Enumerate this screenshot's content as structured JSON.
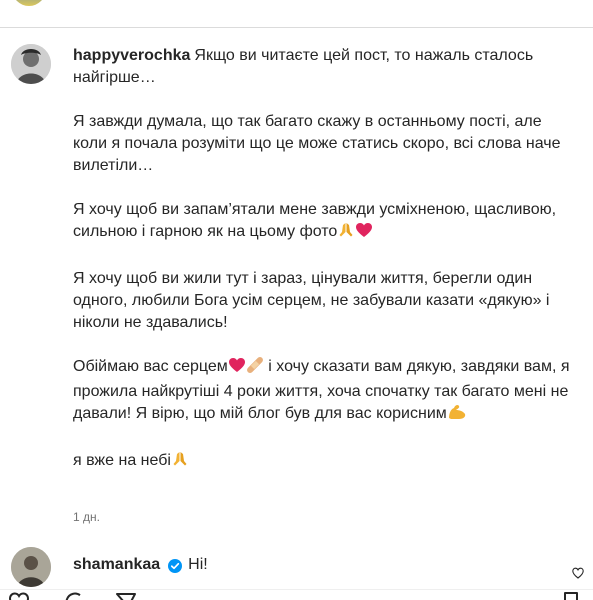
{
  "post": {
    "username": "happyverochka",
    "paragraphs": [
      "Якщо ви читаєте цей пост, то нажаль сталось найгірше…",
      "Я завжди думала, що так багато скажу в останньому пості, але коли я почала розуміти що це може статись скоро, всі слова наче вилетіли…",
      "Я хочу щоб ви запам’ятали мене завжди усміхненою, щасливою, сильною і гарною як на цьому фото",
      "Я хочу щоб ви жили тут і зараз, цінували життя, берегли один одного, любили Бога усім серцем, не забували казати «дякую» і ніколи не здавались!",
      "Обіймаю вас серцем",
      "і хочу сказати вам дякую, завдяки вам, я прожила найкрутіші 4 роки життя, хоча спочатку так багато мені не давали! Я вірю, що мій блог був для вас корисним",
      "я вже на небі"
    ],
    "time_ago": "1 дн."
  },
  "comment": {
    "username": "shamankaa",
    "text": "Ні!",
    "verified": true
  },
  "icons": {
    "praying_hands": "praying-hands-icon",
    "red_heart": "red-heart-icon",
    "bandage": "bandage-icon",
    "flexed_biceps": "flexed-biceps-icon",
    "verified_badge": "verified-badge-icon",
    "like": "heart-icon"
  },
  "colors": {
    "text": "#262626",
    "secondary": "#737373",
    "verified": "#0095f6",
    "heart": "#e0245e"
  }
}
